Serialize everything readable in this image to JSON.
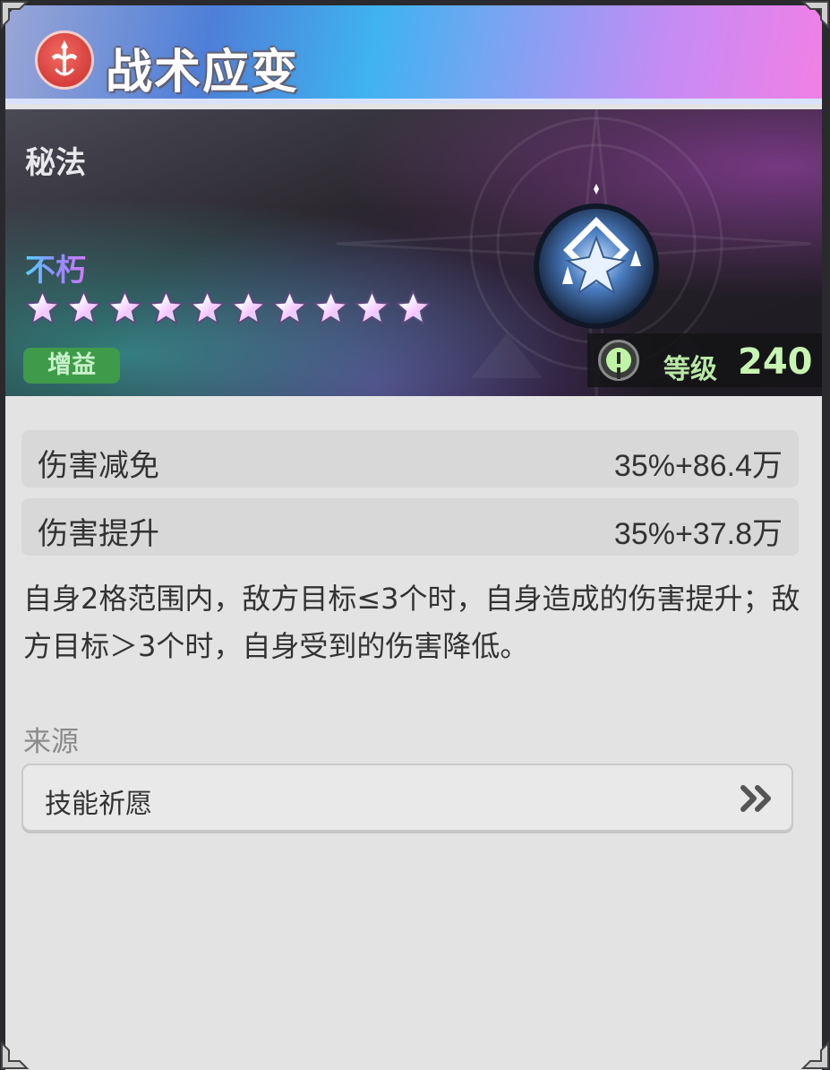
{
  "title": "战术应变",
  "category": "秘法",
  "rarity": "不朽",
  "star_count": 10,
  "tag": "增益",
  "level": {
    "label": "等级",
    "value": "240"
  },
  "stats": [
    {
      "name": "伤害减免",
      "value": "35%+86.4万"
    },
    {
      "name": "伤害提升",
      "value": "35%+37.8万"
    }
  ],
  "description": "自身2格范围内，敌方目标≤3个时，自身造成的伤害提升；敌方目标＞3个时，自身受到的伤害降低。",
  "source": {
    "label": "来源",
    "item": "技能祈愿"
  },
  "icons": {
    "emblem": "crest-icon",
    "skill": "shield-star-icon",
    "warning": "exclamation-icon",
    "source_arrow": "double-chevron-right-icon"
  },
  "colors": {
    "tag_bg": "#3f9a4a",
    "level_text": "#c8f5b2",
    "emblem": "#d63f3b"
  }
}
